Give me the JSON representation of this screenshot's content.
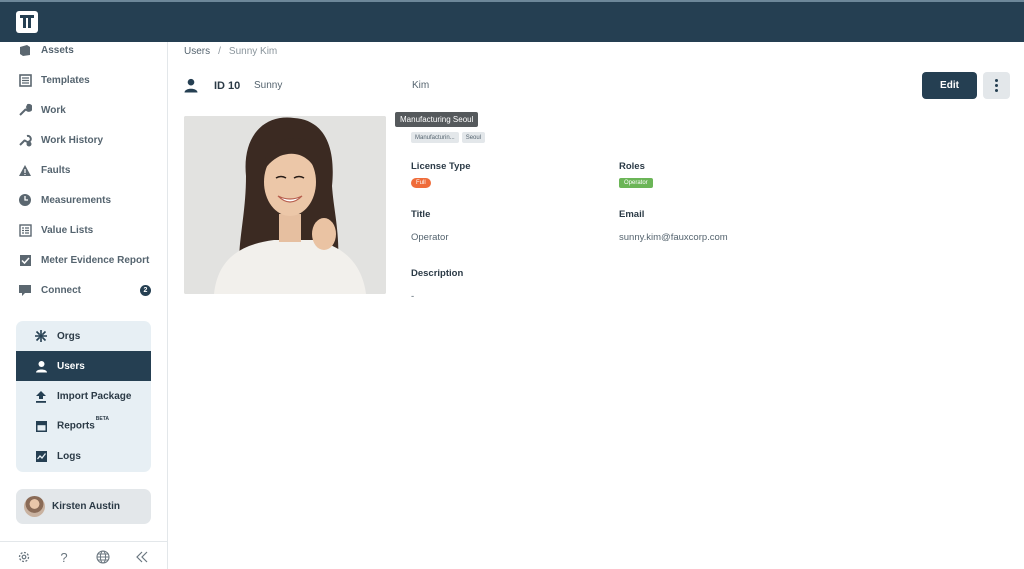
{
  "sidebar": {
    "nav": [
      {
        "label": "Assets",
        "icon": "assets-icon"
      },
      {
        "label": "Templates",
        "icon": "templates-icon"
      },
      {
        "label": "Work",
        "icon": "wrench-icon"
      },
      {
        "label": "Work History",
        "icon": "work-history-icon"
      },
      {
        "label": "Faults",
        "icon": "warning-icon"
      },
      {
        "label": "Measurements",
        "icon": "measurements-icon"
      },
      {
        "label": "Value Lists",
        "icon": "value-lists-icon"
      },
      {
        "label": "Meter Evidence Report",
        "icon": "checkbox-icon"
      },
      {
        "label": "Connect",
        "icon": "chat-icon",
        "badge": "2"
      }
    ],
    "admin": [
      {
        "label": "Orgs",
        "icon": "orgs-icon"
      },
      {
        "label": "Users",
        "icon": "user-icon",
        "active": true
      },
      {
        "label": "Import Package",
        "icon": "upload-icon"
      },
      {
        "label": "Reports",
        "icon": "reports-icon",
        "superscript": "BETA"
      },
      {
        "label": "Logs",
        "icon": "chart-line-icon"
      }
    ],
    "current_user": "Kirsten Austin",
    "footer_icons": [
      "gear-icon",
      "help-icon",
      "globe-icon",
      "collapse-icon"
    ],
    "footer_help_text": "?"
  },
  "breadcrumb": {
    "root": "Users",
    "separator": "/",
    "current": "Sunny Kim"
  },
  "user": {
    "id_label": "ID 10",
    "first_name": "Sunny",
    "last_name": "Kim",
    "tooltip": "Manufacturing Seoul",
    "chips": [
      "Manufacturin...",
      "Seoul"
    ],
    "license_type_label": "License Type",
    "license_type": "Full",
    "roles_label": "Roles",
    "role": "Operator",
    "title_label": "Title",
    "title": "Operator",
    "email_label": "Email",
    "email": "sunny.kim@fauxcorp.com",
    "description_label": "Description",
    "description": "-"
  },
  "actions": {
    "edit_label": "Edit"
  },
  "colors": {
    "primary": "#253f52",
    "license_full": "#ef6c3a",
    "role_operator": "#6bb557"
  }
}
